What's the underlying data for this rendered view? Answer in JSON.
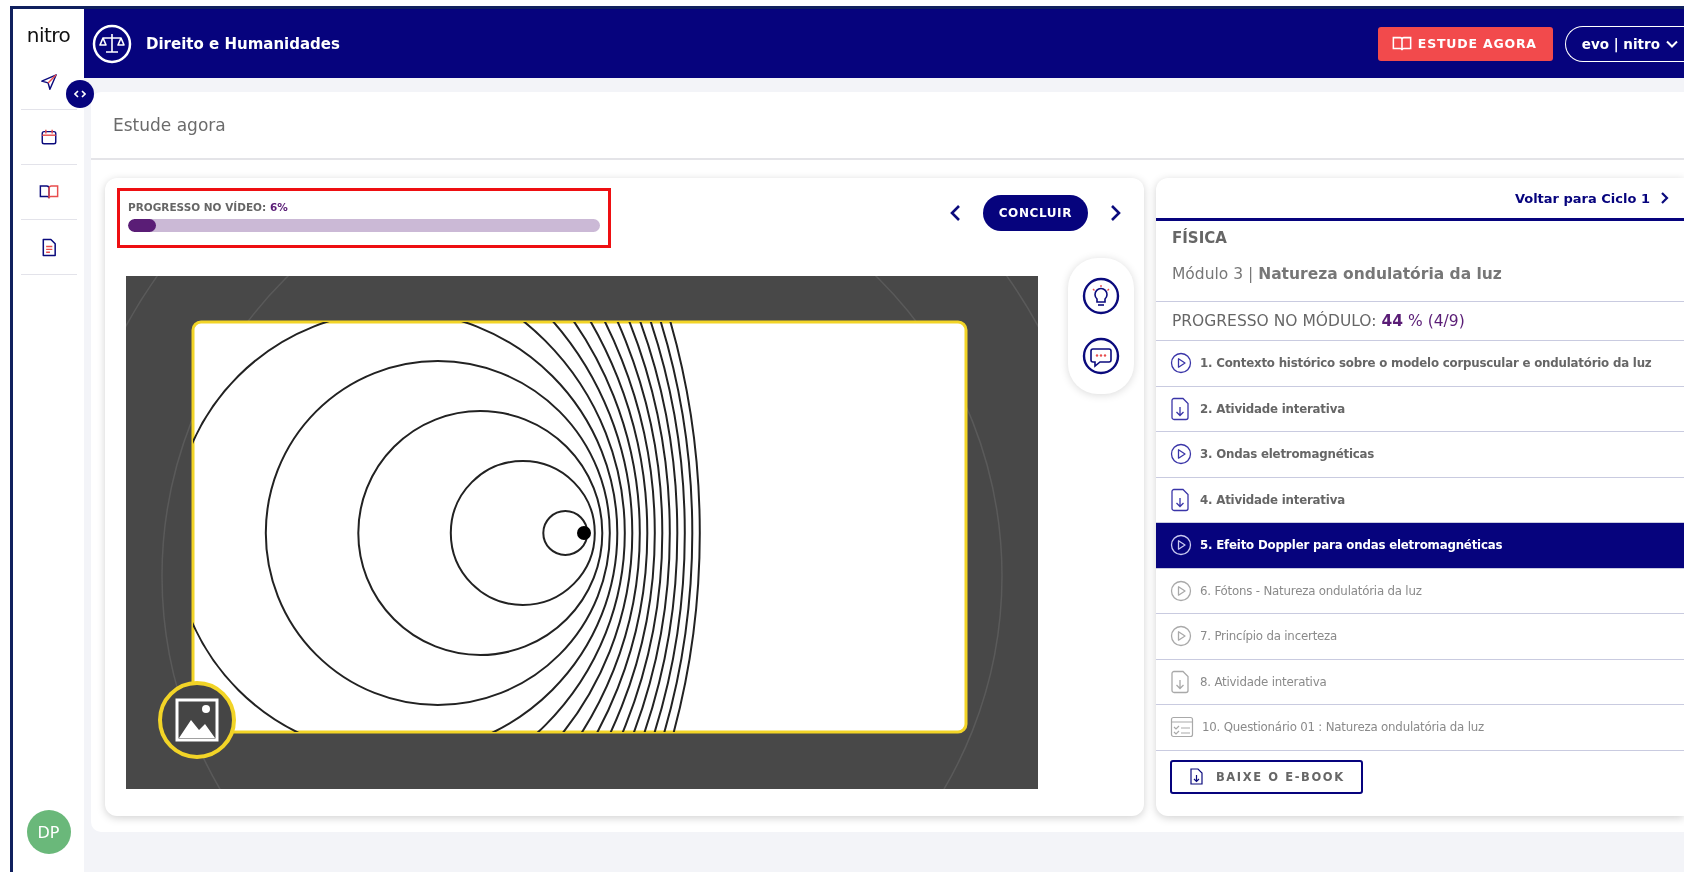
{
  "sidebar": {
    "logo": "nitro",
    "avatar": "DP"
  },
  "header": {
    "title": "Direito e Humanidades",
    "study_button": "ESTUDE AGORA",
    "user_menu": "evo | nitro"
  },
  "page": {
    "title": "Estude agora"
  },
  "video_panel": {
    "progress_label": "PROGRESSO NO VÍDEO:",
    "progress_value": "6%",
    "level": 0.06,
    "complete_button": "CONCLUIR"
  },
  "module_panel": {
    "back_link": "Voltar para Ciclo 1",
    "subject": "FÍSICA",
    "module": "Módulo 3 | **Natureza ondulatória da luz**",
    "progress_label": "PROGRESSO NO MÓDULO:",
    "progress_value": "**44** % (4/9)",
    "lessons": [
      {
        "kind": "video",
        "label": "1. Contexto histórico sobre o modelo corpuscular e ondulatório da luz",
        "done": true,
        "selected": false
      },
      {
        "kind": "activity",
        "label": "2. Atividade interativa",
        "done": true,
        "selected": false
      },
      {
        "kind": "video",
        "label": "3. Ondas eletromagnéticas",
        "done": true,
        "selected": false
      },
      {
        "kind": "activity",
        "label": "4. Atividade interativa",
        "done": true,
        "selected": false
      },
      {
        "kind": "video",
        "label": "5. Efeito Doppler para ondas eletromagnéticas",
        "done": false,
        "selected": true
      },
      {
        "kind": "video",
        "label": "6. Fótons - Natureza ondulatória da luz",
        "done": false,
        "selected": false
      },
      {
        "kind": "video",
        "label": "7. Princípio da incerteza",
        "done": false,
        "selected": false
      },
      {
        "kind": "activity",
        "label": "8. Atividade interativa",
        "done": false,
        "selected": false
      },
      {
        "kind": "quiz",
        "label": "10. Questionário 01 : Natureza ondulatória da luz",
        "done": false,
        "selected": false
      }
    ],
    "ebook_button": "BAIXE O E-BOOK"
  }
}
